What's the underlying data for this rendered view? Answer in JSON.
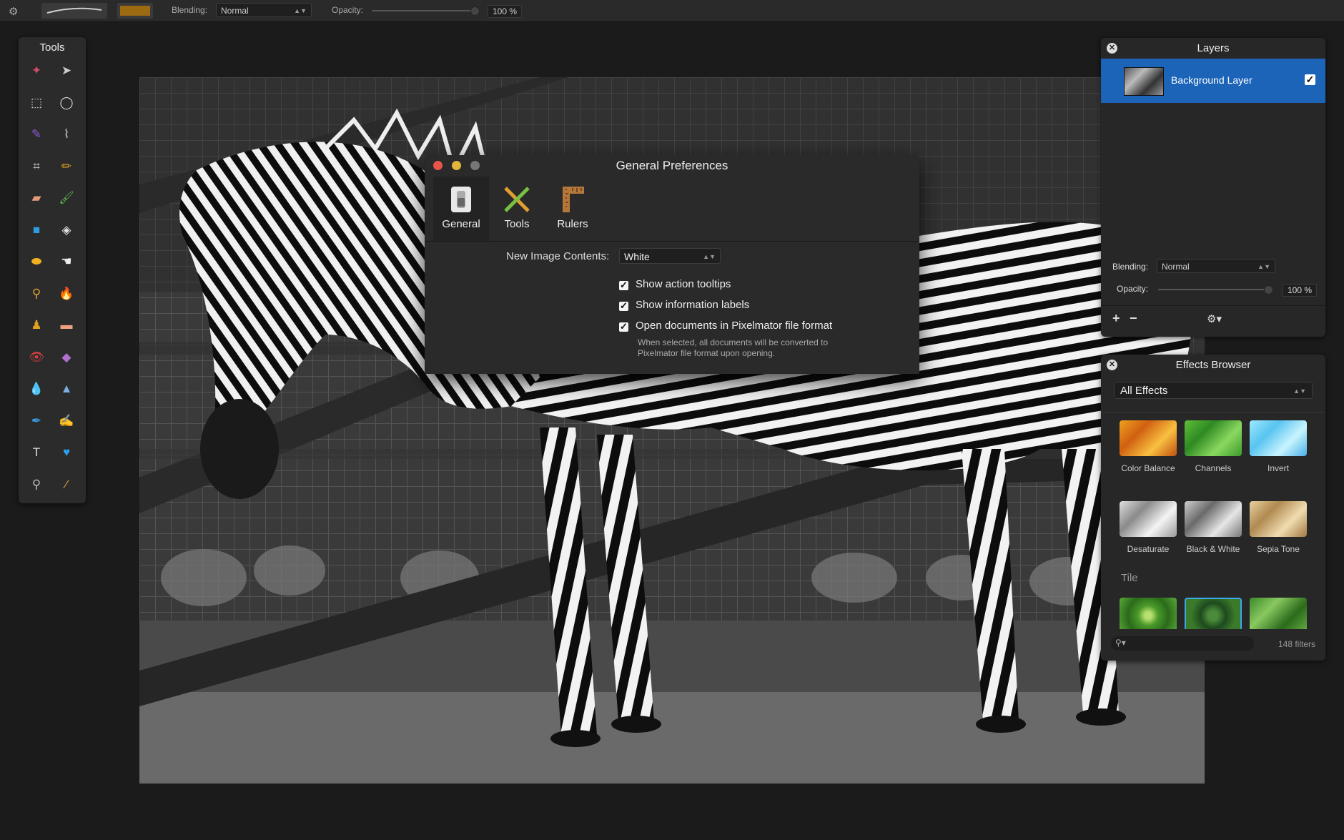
{
  "topbar": {
    "gear_icon": "gear-icon",
    "blending_label": "Blending:",
    "blending_value": "Normal",
    "opacity_label": "Opacity:",
    "opacity_value": "100 %",
    "color": "#9c6a10"
  },
  "tools": {
    "title": "Tools",
    "items": [
      {
        "name": "magic-wand-icon",
        "glyph": "✦",
        "color": "#d24a6a"
      },
      {
        "name": "move-arrow-icon",
        "glyph": "➤",
        "color": "#ccc"
      },
      {
        "name": "rect-select-icon",
        "glyph": "⬚",
        "color": "#ddd"
      },
      {
        "name": "ellipse-select-icon",
        "glyph": "◯",
        "color": "#ddd"
      },
      {
        "name": "quick-select-icon",
        "glyph": "✎",
        "color": "#8e5ad6"
      },
      {
        "name": "lasso-icon",
        "glyph": "⌇",
        "color": "#ccc"
      },
      {
        "name": "crop-icon",
        "glyph": "⌗",
        "color": "#bbb"
      },
      {
        "name": "pencil-icon",
        "glyph": "✏",
        "color": "#e0a020"
      },
      {
        "name": "eraser-icon",
        "glyph": "▰",
        "color": "#e39a7b"
      },
      {
        "name": "brush-icon",
        "glyph": "🖌",
        "color": "#5ab84a"
      },
      {
        "name": "shape-rect-icon",
        "glyph": "■",
        "color": "#2d9de0"
      },
      {
        "name": "paint-bucket-icon",
        "glyph": "◈",
        "color": "#ddd"
      },
      {
        "name": "sponge-icon",
        "glyph": "⬬",
        "color": "#f0b020"
      },
      {
        "name": "smudge-icon",
        "glyph": "☚",
        "color": "#eee"
      },
      {
        "name": "dodge-icon",
        "glyph": "⚲",
        "color": "#e0a030"
      },
      {
        "name": "burn-icon",
        "glyph": "🔥",
        "color": "#e06020"
      },
      {
        "name": "clone-stamp-icon",
        "glyph": "♟",
        "color": "#e0a020"
      },
      {
        "name": "heal-bandage-icon",
        "glyph": "▬",
        "color": "#f0a080"
      },
      {
        "name": "red-eye-icon",
        "glyph": "👁",
        "color": "#e04040"
      },
      {
        "name": "light-eraser-icon",
        "glyph": "◆",
        "color": "#b070d0"
      },
      {
        "name": "blur-drop-icon",
        "glyph": "💧",
        "color": "#6aa0e0"
      },
      {
        "name": "sharpen-cone-icon",
        "glyph": "▲",
        "color": "#7ab0e0"
      },
      {
        "name": "pen-icon",
        "glyph": "✒",
        "color": "#3a9ae0"
      },
      {
        "name": "freeform-pen-icon",
        "glyph": "✍",
        "color": "#3a9ae0"
      },
      {
        "name": "type-icon",
        "glyph": "T",
        "color": "#ddd"
      },
      {
        "name": "custom-shape-heart-icon",
        "glyph": "♥",
        "color": "#2aa0f0"
      },
      {
        "name": "zoom-icon",
        "glyph": "⚲",
        "color": "#bbb"
      },
      {
        "name": "eyedropper-icon",
        "glyph": "⁄",
        "color": "#e0a040"
      }
    ]
  },
  "prefs": {
    "title": "General Preferences",
    "tabs": [
      {
        "label": "General",
        "icon": "switch-icon"
      },
      {
        "label": "Tools",
        "icon": "tools-icon"
      },
      {
        "label": "Rulers",
        "icon": "ruler-icon"
      }
    ],
    "new_image_label": "New Image Contents:",
    "new_image_value": "White",
    "checks": [
      {
        "label": "Show action tooltips",
        "checked": true
      },
      {
        "label": "Show information labels",
        "checked": true
      },
      {
        "label": "Open documents in Pixelmator file format",
        "checked": true
      }
    ],
    "help_line1": "When selected, all documents will be converted to",
    "help_line2": "Pixelmator file format upon opening."
  },
  "layers": {
    "title": "Layers",
    "layer_name": "Background Layer",
    "blending_label": "Blending:",
    "blending_value": "Normal",
    "opacity_label": "Opacity:",
    "opacity_value": "100 %",
    "add_label": "+",
    "remove_label": "−",
    "accent": "#1c64b8"
  },
  "effects": {
    "title": "Effects Browser",
    "category": "All Effects",
    "row1": [
      {
        "label": "Color Balance",
        "bg": "linear-gradient(135deg,#f0a020,#d06010,#f8c040,#c05010)"
      },
      {
        "label": "Channels",
        "bg": "linear-gradient(135deg,#5fbf3a,#2e8a22,#8ad860,#3a9a2a)"
      },
      {
        "label": "Invert",
        "bg": "linear-gradient(135deg,#a0e8ff,#58c4f0,#c8f4ff,#4ab0e8)"
      }
    ],
    "row2": [
      {
        "label": "Desaturate",
        "bg": "linear-gradient(135deg,#e0e0e0,#8a8a8a,#f4f4f4,#999)"
      },
      {
        "label": "Black & White",
        "bg": "linear-gradient(135deg,#cfcfcf,#6a6a6a,#e6e6e6,#777)"
      },
      {
        "label": "Sepia Tone",
        "bg": "linear-gradient(135deg,#e8d0a0,#b08a50,#f0dcb0,#a07840)"
      }
    ],
    "group": "Tile",
    "row3": [
      {
        "bg": "radial-gradient(circle,#b8e070 10%,#4a9a2a 30%,#2a6a1a 60%,#5aaa3a)"
      },
      {
        "bg": "radial-gradient(circle,#4a8a3a 15%,#1e4a1e 40%,#3a7a2a 70%)"
      },
      {
        "bg": "linear-gradient(135deg,#3a8a2a,#8ac860,#2a6a1a,#6ab048)"
      }
    ],
    "count": "148 filters"
  }
}
